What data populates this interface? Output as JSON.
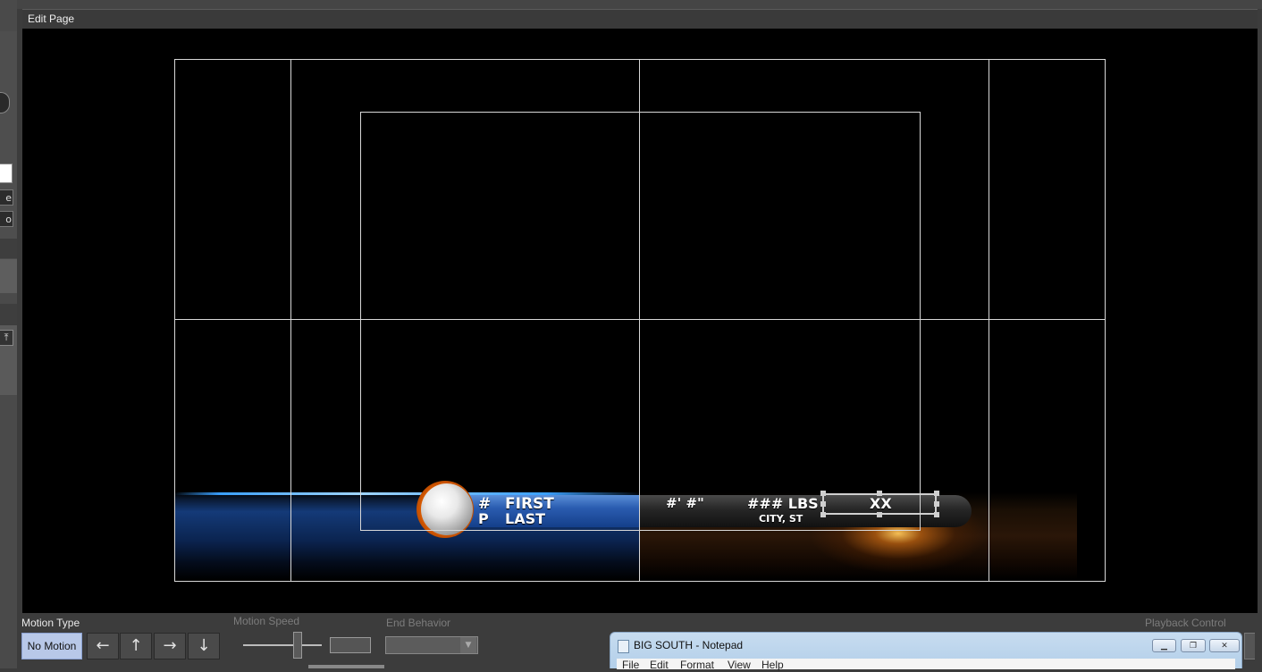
{
  "window": {
    "panel_title": "Edit Page"
  },
  "sidebar": {
    "buttons": [
      {
        "label": "e"
      },
      {
        "label": "o"
      }
    ]
  },
  "graphic": {
    "number": "#",
    "position": "P",
    "first_name": "FIRST",
    "last_name": "LAST",
    "height": "#' #\"",
    "weight": "### LBS",
    "hometown": "CITY, ST",
    "selected_field": "XX"
  },
  "toolbar": {
    "motion_type_label": "Motion Type",
    "no_motion_label": "No Motion",
    "arrow_buttons": [
      {
        "icon": "arrow-left-icon",
        "glyph": "←"
      },
      {
        "icon": "arrow-up-icon",
        "glyph": "↑"
      },
      {
        "icon": "arrow-right-icon",
        "glyph": "→"
      },
      {
        "icon": "arrow-down-icon",
        "glyph": "↓"
      }
    ],
    "motion_speed_label": "Motion Speed",
    "motion_speed_value": "",
    "end_behavior_label": "End Behavior",
    "end_behavior_value": "",
    "playback_control_label": "Playback Control"
  },
  "notepad": {
    "title": "BIG SOUTH - Notepad",
    "menu": [
      "File",
      "Edit",
      "Format",
      "View",
      "Help"
    ],
    "controls": [
      "minimize",
      "restore",
      "close"
    ]
  },
  "colors": {
    "canvas_bg": "#000000",
    "guide_lines": "#d8d8d8",
    "name_bar_blue": "#2a5cb0",
    "ball_ring_orange": "#d85a00",
    "selected_button": "#b8c8e8"
  }
}
